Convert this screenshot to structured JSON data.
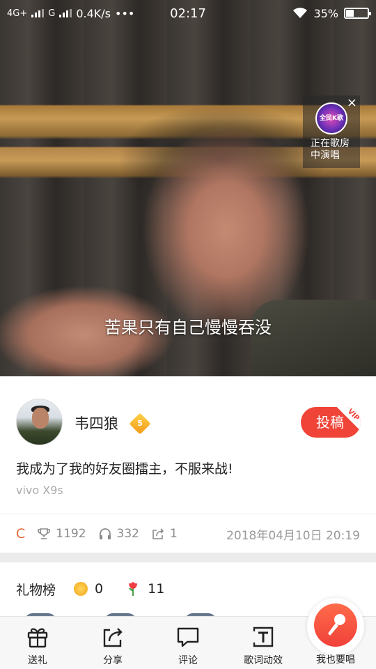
{
  "status_bar": {
    "network1": "4G+",
    "network2": "G",
    "speed": "0.4K/s",
    "dots": "•••",
    "time": "02:17",
    "battery_percent": "35%",
    "battery_level": 0.35
  },
  "video": {
    "lyric": "苦果只有自己慢慢吞没"
  },
  "room_widget": {
    "avatar_text": "全民K歌",
    "line1": "正在歌房",
    "line2": "中演唱",
    "close_glyph": "×"
  },
  "user": {
    "name": "韦四狼",
    "level": "5",
    "submit_label": "投稿",
    "vip_tag": "VIP"
  },
  "post": {
    "description": "我成为了我的好友圈擂主，不服来战!",
    "device": "vivo X9s"
  },
  "stats": {
    "grade": "C",
    "trophies": "1192",
    "listens": "332",
    "shares": "1",
    "date": "2018年04月10日 20:19"
  },
  "gifts": {
    "title": "礼物榜",
    "coins": "0",
    "flowers": "11"
  },
  "bottom_nav": {
    "gift": "送礼",
    "share": "分享",
    "comment": "评论",
    "lyric_effect": "歌词动效",
    "sing_too": "我也要唱"
  },
  "colors": {
    "accent_red": "#f04438",
    "grade_orange": "#e46b3c"
  }
}
